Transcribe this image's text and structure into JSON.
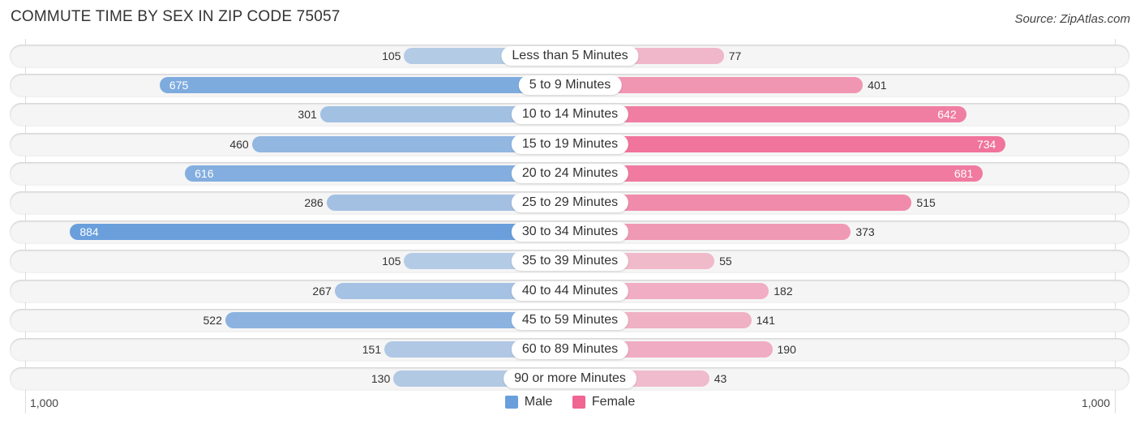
{
  "chart_data": {
    "type": "bar",
    "orientation": "horizontal-diverging",
    "title": "COMMUTE TIME BY SEX IN ZIP CODE 75057",
    "source": "Source: ZipAtlas.com",
    "categories": [
      "Less than 5 Minutes",
      "5 to 9 Minutes",
      "10 to 14 Minutes",
      "15 to 19 Minutes",
      "20 to 24 Minutes",
      "25 to 29 Minutes",
      "30 to 34 Minutes",
      "35 to 39 Minutes",
      "40 to 44 Minutes",
      "45 to 59 Minutes",
      "60 to 89 Minutes",
      "90 or more Minutes"
    ],
    "series": [
      {
        "name": "Male",
        "color": "#6a9fdc",
        "values": [
          105,
          675,
          301,
          460,
          616,
          286,
          884,
          105,
          267,
          522,
          151,
          130
        ]
      },
      {
        "name": "Female",
        "color": "#f06592",
        "values": [
          77,
          401,
          642,
          734,
          681,
          515,
          373,
          55,
          182,
          141,
          190,
          43
        ]
      }
    ],
    "xlim": [
      -1000,
      1000
    ],
    "tick_labels": {
      "left": "1,000",
      "right": "1,000"
    },
    "legend_position": "bottom-center",
    "grid": false
  }
}
